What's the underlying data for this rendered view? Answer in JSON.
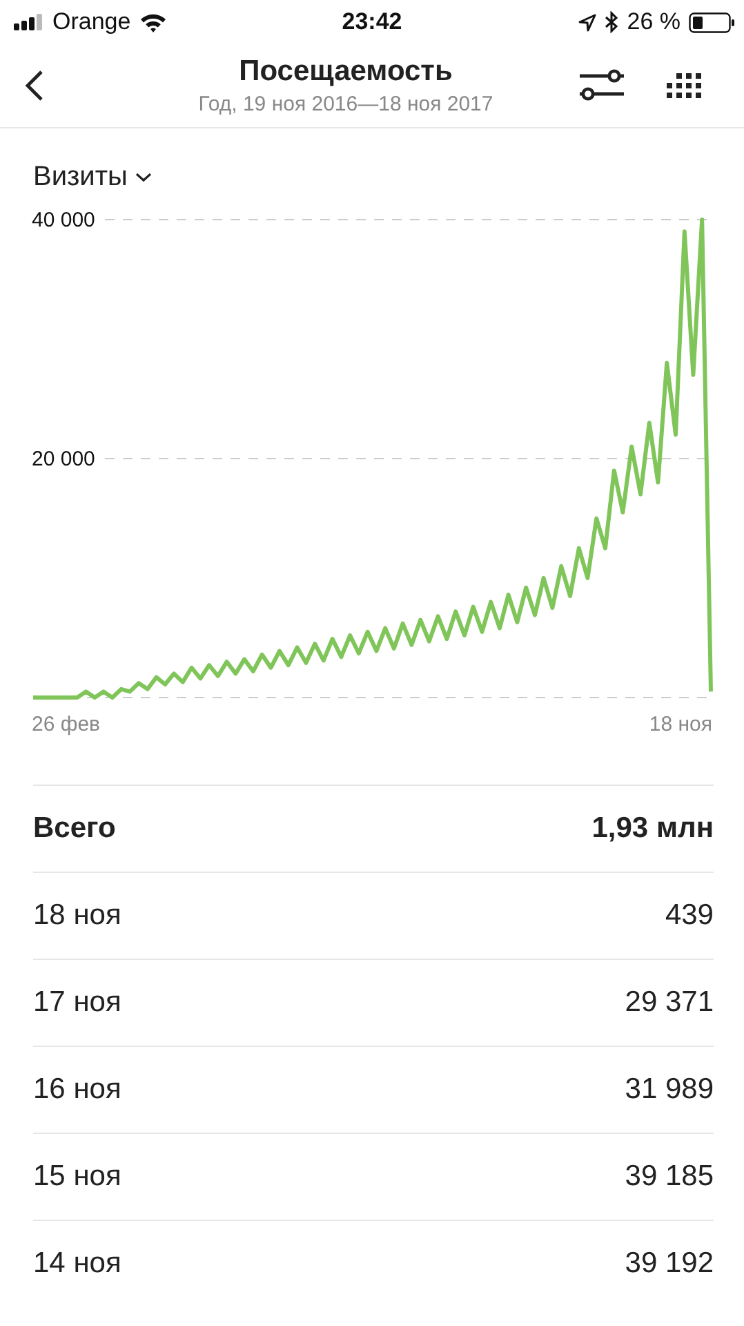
{
  "status_bar": {
    "carrier": "Orange",
    "time": "23:42",
    "battery": "26 %"
  },
  "header": {
    "title": "Посещаемость",
    "subtitle": "Год, 19 ноя 2016—18 ноя 2017"
  },
  "metric_selector": {
    "label": "Визиты"
  },
  "chart_data": {
    "type": "line",
    "ylim": [
      0,
      40000
    ],
    "yticks": [
      {
        "value": 20000,
        "label": "20 000"
      },
      {
        "value": 40000,
        "label": "40 000"
      }
    ],
    "series": [
      {
        "color": "#80c55a",
        "values": [
          0,
          0,
          0,
          0,
          0,
          0,
          500,
          0,
          500,
          0,
          700,
          500,
          1200,
          700,
          1700,
          1100,
          2000,
          1300,
          2500,
          1600,
          2700,
          1800,
          3000,
          2000,
          3200,
          2200,
          3600,
          2500,
          3900,
          2700,
          4200,
          2900,
          4500,
          3100,
          4900,
          3400,
          5200,
          3700,
          5500,
          3900,
          5800,
          4100,
          6200,
          4400,
          6500,
          4700,
          6800,
          4900,
          7200,
          5200,
          7600,
          5500,
          8000,
          5800,
          8600,
          6300,
          9200,
          6900,
          10000,
          7500,
          11000,
          8500,
          12500,
          10000,
          15000,
          12500,
          19000,
          15500,
          21000,
          17000,
          23000,
          18000,
          28000,
          22000,
          39000,
          27000,
          40000,
          500
        ]
      }
    ]
  },
  "x_axis_labels": [
    "26 фев",
    "18 ноя"
  ],
  "summary": {
    "label": "Всего",
    "value": "1,93 млн"
  },
  "rows": [
    {
      "date": "18 ноя",
      "value": "439"
    },
    {
      "date": "17 ноя",
      "value": "29 371"
    },
    {
      "date": "16 ноя",
      "value": "31 989"
    },
    {
      "date": "15 ноя",
      "value": "39 185"
    },
    {
      "date": "14 ноя",
      "value": "39 192"
    }
  ]
}
